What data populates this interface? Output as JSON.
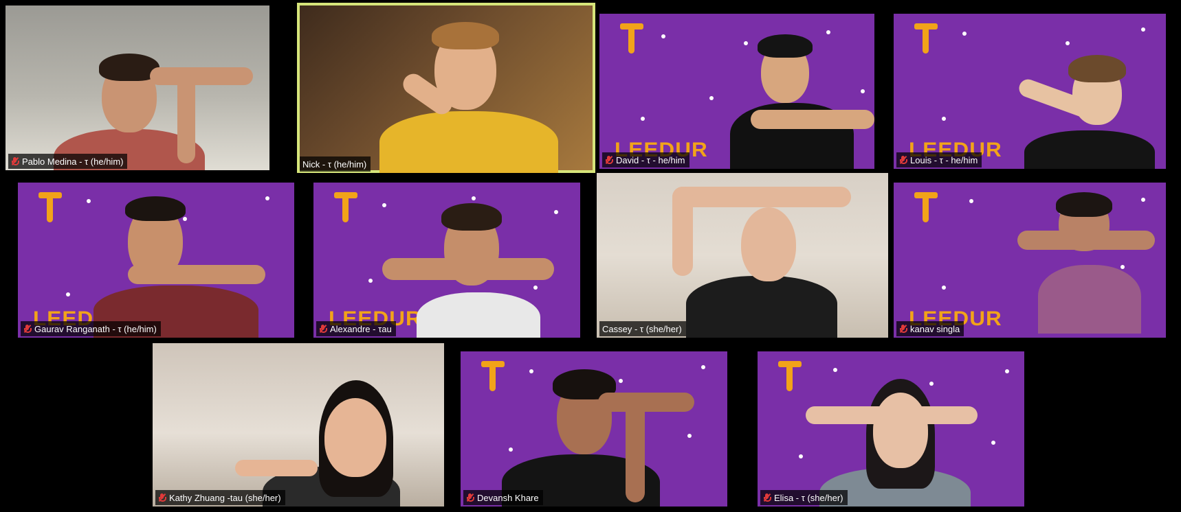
{
  "brand": {
    "logo_text": "LEEDUR",
    "accent": "#f2a319",
    "backdrop": "#7a2fa8",
    "active_outline": "#d6e57a",
    "muted_icon": "mic-muted-icon"
  },
  "participants": [
    {
      "name": "Pablo Medina - τ (he/him)",
      "muted": true
    },
    {
      "name": "Nick - τ (he/him)",
      "muted": false,
      "active": true
    },
    {
      "name": "David - τ - he/him",
      "muted": true
    },
    {
      "name": "Louis - τ - he/him",
      "muted": true
    },
    {
      "name": "Gaurav Ranganath - τ (he/him)",
      "muted": true
    },
    {
      "name": "Alexandre - τau",
      "muted": true
    },
    {
      "name": "Cassey - τ (she/her)",
      "muted": false
    },
    {
      "name": "kanav singla",
      "muted": true
    },
    {
      "name": "Kathy Zhuang -tau (she/her)",
      "muted": true
    },
    {
      "name": "Devansh Khare",
      "muted": true
    },
    {
      "name": "Elisa - τ (she/her)",
      "muted": true
    }
  ]
}
